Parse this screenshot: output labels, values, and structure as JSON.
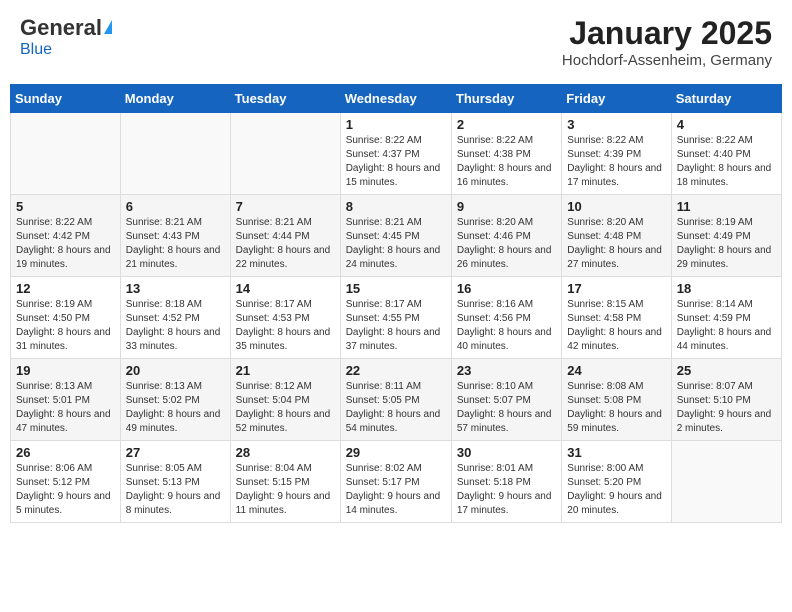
{
  "header": {
    "logo_general": "General",
    "logo_blue": "Blue",
    "month_title": "January 2025",
    "location": "Hochdorf-Assenheim, Germany"
  },
  "days_of_week": [
    "Sunday",
    "Monday",
    "Tuesday",
    "Wednesday",
    "Thursday",
    "Friday",
    "Saturday"
  ],
  "weeks": [
    [
      {
        "day": "",
        "info": ""
      },
      {
        "day": "",
        "info": ""
      },
      {
        "day": "",
        "info": ""
      },
      {
        "day": "1",
        "info": "Sunrise: 8:22 AM\nSunset: 4:37 PM\nDaylight: 8 hours\nand 15 minutes."
      },
      {
        "day": "2",
        "info": "Sunrise: 8:22 AM\nSunset: 4:38 PM\nDaylight: 8 hours\nand 16 minutes."
      },
      {
        "day": "3",
        "info": "Sunrise: 8:22 AM\nSunset: 4:39 PM\nDaylight: 8 hours\nand 17 minutes."
      },
      {
        "day": "4",
        "info": "Sunrise: 8:22 AM\nSunset: 4:40 PM\nDaylight: 8 hours\nand 18 minutes."
      }
    ],
    [
      {
        "day": "5",
        "info": "Sunrise: 8:22 AM\nSunset: 4:42 PM\nDaylight: 8 hours\nand 19 minutes."
      },
      {
        "day": "6",
        "info": "Sunrise: 8:21 AM\nSunset: 4:43 PM\nDaylight: 8 hours\nand 21 minutes."
      },
      {
        "day": "7",
        "info": "Sunrise: 8:21 AM\nSunset: 4:44 PM\nDaylight: 8 hours\nand 22 minutes."
      },
      {
        "day": "8",
        "info": "Sunrise: 8:21 AM\nSunset: 4:45 PM\nDaylight: 8 hours\nand 24 minutes."
      },
      {
        "day": "9",
        "info": "Sunrise: 8:20 AM\nSunset: 4:46 PM\nDaylight: 8 hours\nand 26 minutes."
      },
      {
        "day": "10",
        "info": "Sunrise: 8:20 AM\nSunset: 4:48 PM\nDaylight: 8 hours\nand 27 minutes."
      },
      {
        "day": "11",
        "info": "Sunrise: 8:19 AM\nSunset: 4:49 PM\nDaylight: 8 hours\nand 29 minutes."
      }
    ],
    [
      {
        "day": "12",
        "info": "Sunrise: 8:19 AM\nSunset: 4:50 PM\nDaylight: 8 hours\nand 31 minutes."
      },
      {
        "day": "13",
        "info": "Sunrise: 8:18 AM\nSunset: 4:52 PM\nDaylight: 8 hours\nand 33 minutes."
      },
      {
        "day": "14",
        "info": "Sunrise: 8:17 AM\nSunset: 4:53 PM\nDaylight: 8 hours\nand 35 minutes."
      },
      {
        "day": "15",
        "info": "Sunrise: 8:17 AM\nSunset: 4:55 PM\nDaylight: 8 hours\nand 37 minutes."
      },
      {
        "day": "16",
        "info": "Sunrise: 8:16 AM\nSunset: 4:56 PM\nDaylight: 8 hours\nand 40 minutes."
      },
      {
        "day": "17",
        "info": "Sunrise: 8:15 AM\nSunset: 4:58 PM\nDaylight: 8 hours\nand 42 minutes."
      },
      {
        "day": "18",
        "info": "Sunrise: 8:14 AM\nSunset: 4:59 PM\nDaylight: 8 hours\nand 44 minutes."
      }
    ],
    [
      {
        "day": "19",
        "info": "Sunrise: 8:13 AM\nSunset: 5:01 PM\nDaylight: 8 hours\nand 47 minutes."
      },
      {
        "day": "20",
        "info": "Sunrise: 8:13 AM\nSunset: 5:02 PM\nDaylight: 8 hours\nand 49 minutes."
      },
      {
        "day": "21",
        "info": "Sunrise: 8:12 AM\nSunset: 5:04 PM\nDaylight: 8 hours\nand 52 minutes."
      },
      {
        "day": "22",
        "info": "Sunrise: 8:11 AM\nSunset: 5:05 PM\nDaylight: 8 hours\nand 54 minutes."
      },
      {
        "day": "23",
        "info": "Sunrise: 8:10 AM\nSunset: 5:07 PM\nDaylight: 8 hours\nand 57 minutes."
      },
      {
        "day": "24",
        "info": "Sunrise: 8:08 AM\nSunset: 5:08 PM\nDaylight: 8 hours\nand 59 minutes."
      },
      {
        "day": "25",
        "info": "Sunrise: 8:07 AM\nSunset: 5:10 PM\nDaylight: 9 hours\nand 2 minutes."
      }
    ],
    [
      {
        "day": "26",
        "info": "Sunrise: 8:06 AM\nSunset: 5:12 PM\nDaylight: 9 hours\nand 5 minutes."
      },
      {
        "day": "27",
        "info": "Sunrise: 8:05 AM\nSunset: 5:13 PM\nDaylight: 9 hours\nand 8 minutes."
      },
      {
        "day": "28",
        "info": "Sunrise: 8:04 AM\nSunset: 5:15 PM\nDaylight: 9 hours\nand 11 minutes."
      },
      {
        "day": "29",
        "info": "Sunrise: 8:02 AM\nSunset: 5:17 PM\nDaylight: 9 hours\nand 14 minutes."
      },
      {
        "day": "30",
        "info": "Sunrise: 8:01 AM\nSunset: 5:18 PM\nDaylight: 9 hours\nand 17 minutes."
      },
      {
        "day": "31",
        "info": "Sunrise: 8:00 AM\nSunset: 5:20 PM\nDaylight: 9 hours\nand 20 minutes."
      },
      {
        "day": "",
        "info": ""
      }
    ]
  ]
}
